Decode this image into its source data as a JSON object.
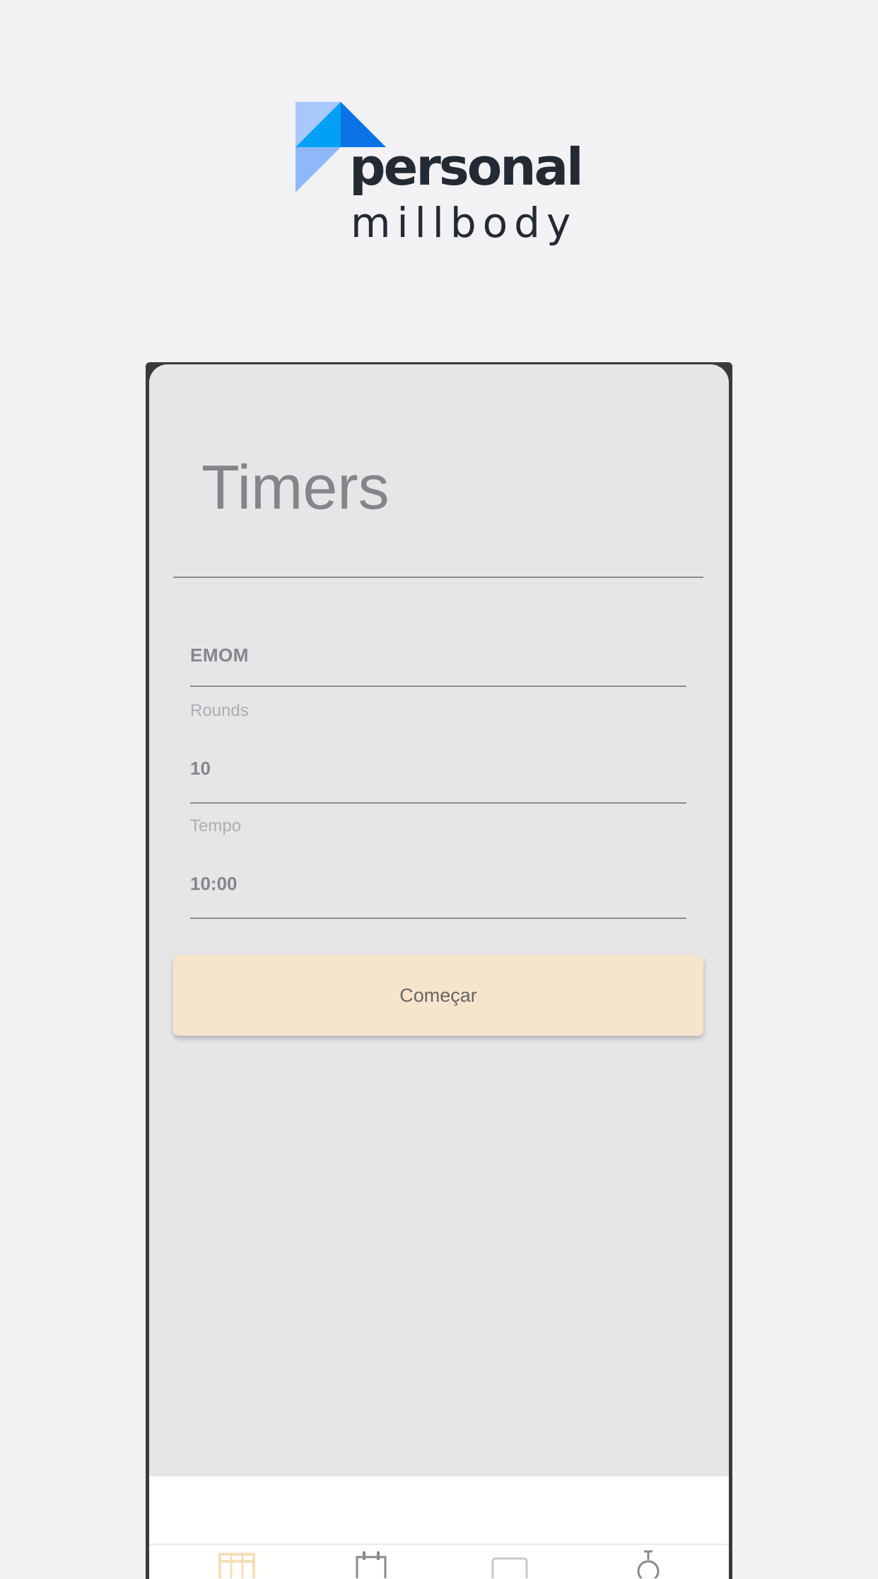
{
  "logo": {
    "word_primary": "personal",
    "word_secondary": "millbody",
    "colors": {
      "light_blue": "#a8c8fb",
      "mid_blue": "#00a0f5",
      "dark_blue": "#0a73e8",
      "pale_blue": "#8fb8fa",
      "text": "#232a31"
    }
  },
  "page": {
    "title": "Timers"
  },
  "form": {
    "timer_type": {
      "value": "EMOM"
    },
    "rounds": {
      "label": "Rounds",
      "value": "10"
    },
    "tempo": {
      "label": "Tempo",
      "value": "10:00"
    },
    "start_button": {
      "label": "Começar",
      "color": "#f6e4cd"
    }
  },
  "tab_bar": {
    "tabs": [
      {
        "icon": "calendar-grid-icon",
        "active": true,
        "color": "#f5dfb8"
      },
      {
        "icon": "calendar-icon",
        "active": false,
        "color": "#8a8a8e"
      },
      {
        "icon": "card-icon",
        "active": false,
        "color": "#c9c9cc"
      },
      {
        "icon": "timer-icon",
        "active": false,
        "color": "#8a8a8e"
      }
    ]
  }
}
